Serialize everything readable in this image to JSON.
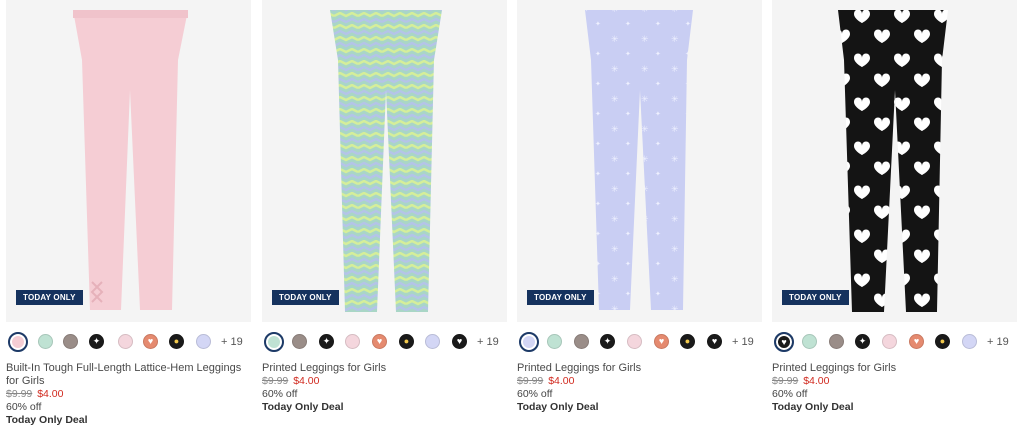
{
  "colors": {
    "badge_bg": "#15325e",
    "sale_red": "#d12a1f",
    "selected_ring": "#1d3a67"
  },
  "products": [
    {
      "badge": "TODAY ONLY",
      "more_colors": "+ 19",
      "title": "Built-In Tough Full-Length Lattice-Hem Leggings for Girls",
      "original_price": "$9.99",
      "sale_price": "$4.00",
      "discount": "60% off",
      "deal": "Today Only Deal",
      "image": "pink-leggings-lattice-hem",
      "swatches": [
        "pink",
        "mint",
        "taupe",
        "black-print",
        "pink-print",
        "coral-heart",
        "black-yellow",
        "lavender"
      ],
      "selected_swatch": 0
    },
    {
      "badge": "TODAY ONLY",
      "more_colors": "+ 19",
      "title": "Printed Leggings for Girls",
      "original_price": "$9.99",
      "sale_price": "$4.00",
      "discount": "60% off",
      "deal": "Today Only Deal",
      "image": "mint-wave-print-leggings",
      "swatches": [
        "mint",
        "taupe",
        "black-print",
        "pink-print",
        "coral-heart",
        "black-yellow",
        "lavender"
      ],
      "selected_swatch": 0
    },
    {
      "badge": "TODAY ONLY",
      "more_colors": "+ 19",
      "title": "Printed Leggings for Girls",
      "original_price": "$9.99",
      "sale_price": "$4.00",
      "discount": "60% off",
      "deal": "Today Only Deal",
      "image": "lavender-star-print-leggings",
      "swatches": [
        "lavender",
        "mint",
        "taupe",
        "black-print",
        "pink-print",
        "coral-heart",
        "black-yellow",
        "black-heart"
      ],
      "selected_swatch": 0
    },
    {
      "badge": "TODAY ONLY",
      "more_colors": "+ 19",
      "title": "Printed Leggings for Girls",
      "original_price": "$9.99",
      "sale_price": "$4.00",
      "discount": "60% off",
      "deal": "Today Only Deal",
      "image": "black-heart-print-leggings",
      "swatches": [
        "black-heart",
        "mint",
        "taupe",
        "black-print",
        "pink-print",
        "coral-heart",
        "black-yellow",
        "lavender"
      ],
      "selected_swatch": 0
    }
  ]
}
